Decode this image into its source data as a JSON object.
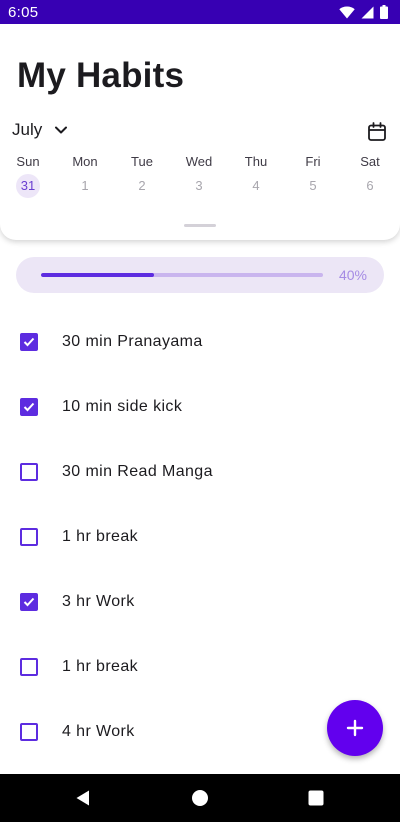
{
  "status_bar": {
    "time": "6:05",
    "icons": [
      "wifi-icon",
      "signal-icon",
      "battery-icon"
    ],
    "color": "#3700b3"
  },
  "header": {
    "title": "My Habits",
    "month": "July",
    "calendar_icon": "calendar-icon",
    "chevron_icon": "chevron-down-icon"
  },
  "week": {
    "days": [
      {
        "name": "Sun",
        "date": "31",
        "selected": true
      },
      {
        "name": "Mon",
        "date": "1",
        "selected": false
      },
      {
        "name": "Tue",
        "date": "2",
        "selected": false
      },
      {
        "name": "Wed",
        "date": "3",
        "selected": false
      },
      {
        "name": "Thu",
        "date": "4",
        "selected": false
      },
      {
        "name": "Fri",
        "date": "5",
        "selected": false
      },
      {
        "name": "Sat",
        "date": "6",
        "selected": false
      }
    ]
  },
  "progress": {
    "value": 0.4,
    "label": "40%"
  },
  "habits": [
    {
      "label": "30 min Pranayama",
      "checked": true
    },
    {
      "label": "10 min side kick",
      "checked": true
    },
    {
      "label": "30 min Read Manga",
      "checked": false
    },
    {
      "label": "1 hr break",
      "checked": false
    },
    {
      "label": "3 hr Work",
      "checked": true
    },
    {
      "label": "1 hr break",
      "checked": false
    },
    {
      "label": "4 hr Work",
      "checked": false
    }
  ],
  "fab": {
    "icon": "plus-icon",
    "color": "#6200ee"
  },
  "nav": {
    "items": [
      "back-icon",
      "home-icon",
      "recents-icon"
    ]
  },
  "colors": {
    "accent": "#5d2ce0",
    "progress_bg": "#ece6f6",
    "selected_day_bg": "#ede6f8"
  }
}
